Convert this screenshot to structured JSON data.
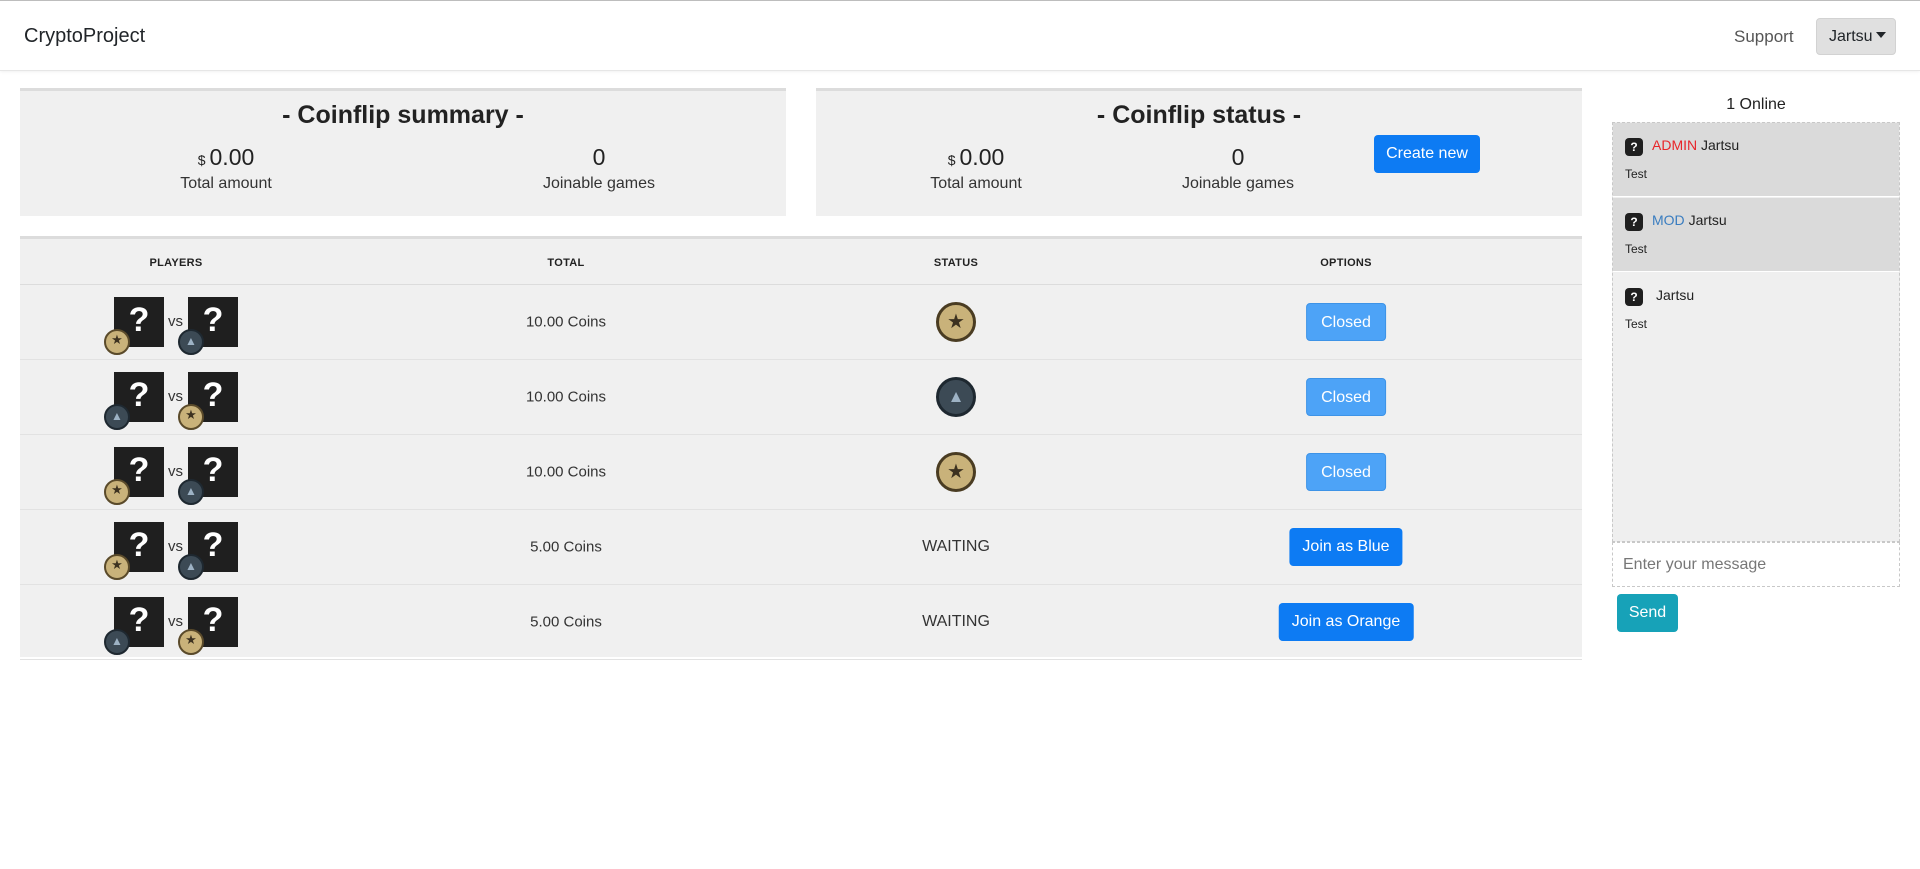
{
  "nav": {
    "brand": "CryptoProject",
    "support": "Support",
    "user": "Jartsu"
  },
  "summary": {
    "title": "- Coinflip summary -",
    "currency": "$",
    "total_amount": "0.00",
    "total_label": "Total amount",
    "joinable": "0",
    "joinable_label": "Joinable games"
  },
  "status_card": {
    "title": "- Coinflip status -",
    "currency": "$",
    "total_amount": "0.00",
    "total_label": "Total amount",
    "joinable": "0",
    "joinable_label": "Joinable games",
    "create_label": "Create new"
  },
  "table": {
    "headers": {
      "players": "PLAYERS",
      "total": "TOTAL",
      "status": "STATUS",
      "options": "OPTIONS"
    },
    "vs_label": "vs",
    "rows": [
      {
        "left_team": "t",
        "right_team": "ct",
        "total": "10.00 Coins",
        "status_icon": "t",
        "status_text": "",
        "action": "Closed",
        "action_kind": "closed"
      },
      {
        "left_team": "ct",
        "right_team": "t",
        "total": "10.00 Coins",
        "status_icon": "ct",
        "status_text": "",
        "action": "Closed",
        "action_kind": "closed"
      },
      {
        "left_team": "t",
        "right_team": "ct",
        "total": "10.00 Coins",
        "status_icon": "t",
        "status_text": "",
        "action": "Closed",
        "action_kind": "closed"
      },
      {
        "left_team": "t",
        "right_team": "ct",
        "total": "5.00 Coins",
        "status_icon": "",
        "status_text": "WAITING",
        "action": "Join as Blue",
        "action_kind": "join"
      },
      {
        "left_team": "ct",
        "right_team": "t",
        "total": "5.00 Coins",
        "status_icon": "",
        "status_text": "WAITING",
        "action": "Join as Orange",
        "action_kind": "join"
      }
    ]
  },
  "chat": {
    "online": "1 Online",
    "messages": [
      {
        "rank": "ADMIN",
        "rank_kind": "admin",
        "user": "Jartsu",
        "text": "Test",
        "highlight": true
      },
      {
        "rank": "MOD",
        "rank_kind": "mod",
        "user": "Jartsu",
        "text": "Test",
        "highlight": true
      },
      {
        "rank": "",
        "rank_kind": "",
        "user": "Jartsu",
        "text": "Test",
        "highlight": false
      }
    ],
    "placeholder": "Enter your message",
    "send_label": "Send"
  },
  "colors": {
    "primary": "#0d7bf3",
    "closed": "#4da3f7",
    "send": "#17a2b8",
    "admin": "#e8262a",
    "mod": "#3a7dc0"
  }
}
